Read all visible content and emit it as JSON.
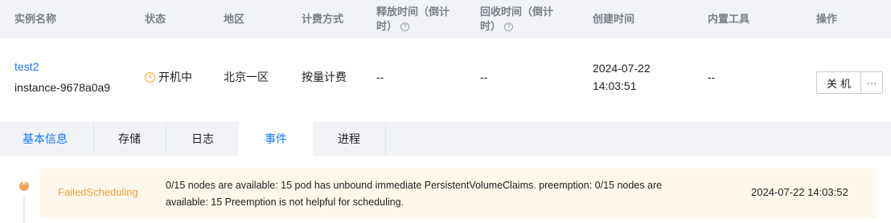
{
  "table": {
    "headers": {
      "name": "实例名称",
      "status": "状态",
      "region": "地区",
      "billing": "计费方式",
      "release_l1": "释放时间（倒计",
      "release_l2": "时）",
      "reclaim_l1": "回收时间（倒计",
      "reclaim_l2": "时）",
      "created": "创建时间",
      "tools": "内置工具",
      "actions": "操作"
    },
    "row": {
      "name": "test2",
      "instance_id": "instance-9678a0a9",
      "status": "开机中",
      "region": "北京一区",
      "billing": "按量计费",
      "release": "--",
      "reclaim": "--",
      "created_date": "2024-07-22",
      "created_time": "14:03:51",
      "tools": "--",
      "shutdown_label": "关机",
      "more_label": "···"
    },
    "help_glyph": "?"
  },
  "tabs": [
    "基本信息",
    "存储",
    "日志",
    "事件",
    "进程"
  ],
  "selected_tab": "事件",
  "event": {
    "reason": "FailedScheduling",
    "message_l1": "0/15 nodes are available: 15 pod has unbound immediate PersistentVolumeClaims. preemption: 0/15 nodes are",
    "message_l2": "available: 15 Preemption is not helpful for scheduling.",
    "time": "2024-07-22 14:03:52"
  },
  "colors": {
    "accent": "#1677ff",
    "warning": "#f5a623",
    "event_bg": "#fdf7ec",
    "header_bg": "#f1f3f6"
  }
}
